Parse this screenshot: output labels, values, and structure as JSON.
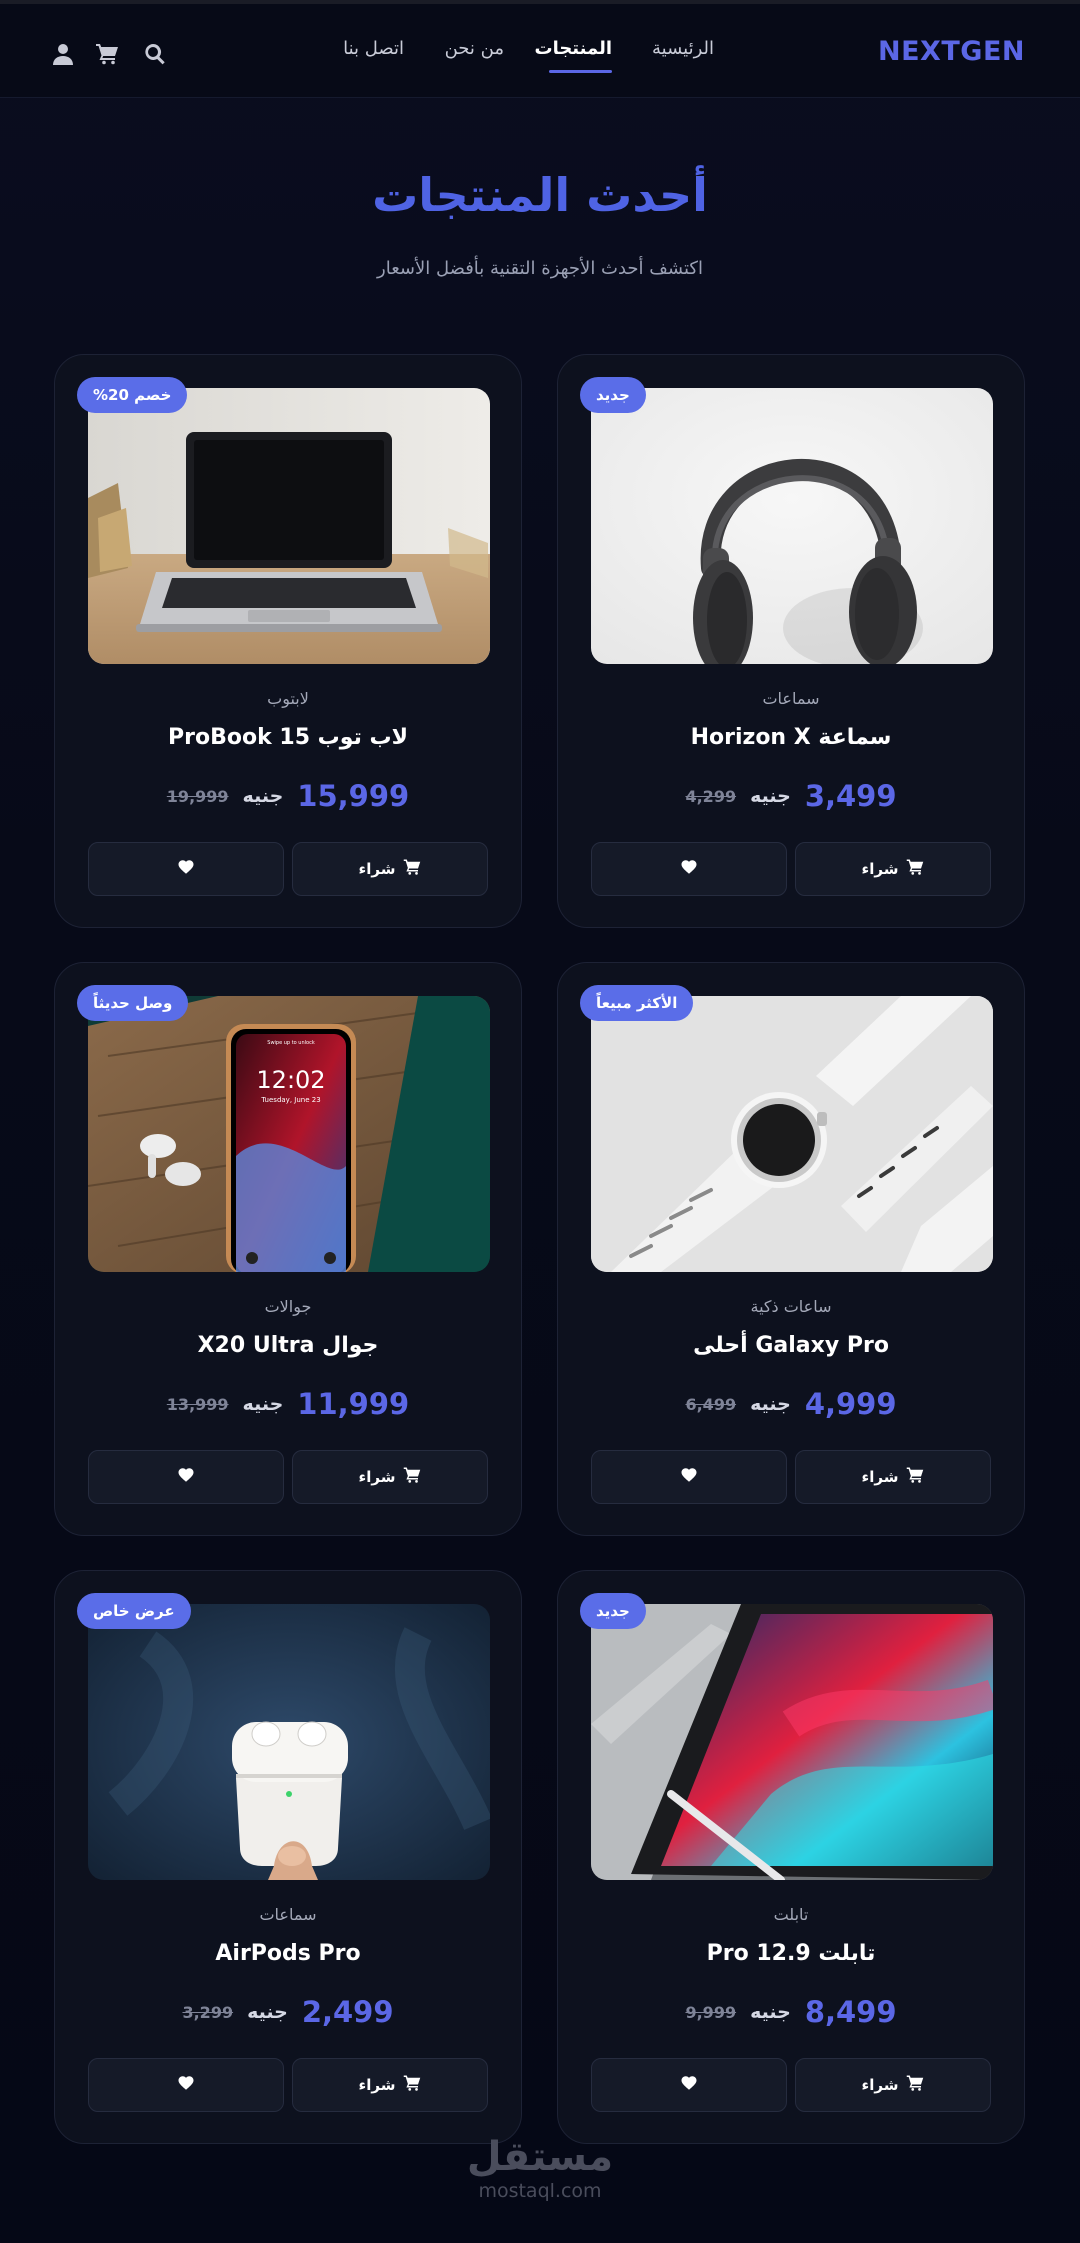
{
  "header": {
    "logo": "NEXTGEN",
    "nav": [
      "الرئيسية",
      "المنتجات",
      "من نحن",
      "اتصل بنا"
    ],
    "active_nav": "المنتجات",
    "icons": [
      "search-icon",
      "cart-icon",
      "user-icon"
    ]
  },
  "hero": {
    "title": "أحدث المنتجات",
    "subtitle": "اكتشف أحدث الأجهزة التقنية بأفضل الأسعار"
  },
  "products": [
    {
      "badge": "جديد",
      "category": "سماعات",
      "name": "سماعة Horizon X",
      "price": "3,499",
      "currency": "جنيه",
      "old_price": "4,299",
      "image": "headphones"
    },
    {
      "badge": "خصم 20%",
      "category": "لابتوب",
      "name": "لاب توب ProBook 15",
      "price": "15,999",
      "currency": "جنيه",
      "old_price": "19,999",
      "image": "laptop"
    },
    {
      "badge": "الأكثر مبيعاً",
      "category": "ساعات ذكية",
      "name": "Galaxy Pro أحلى",
      "price": "4,999",
      "currency": "جنيه",
      "old_price": "6,499",
      "image": "smartwatch"
    },
    {
      "badge": "وصل حديثاً",
      "category": "جوالات",
      "name": "جوال X20 Ultra",
      "price": "11,999",
      "currency": "جنيه",
      "old_price": "13,999",
      "image": "phone"
    },
    {
      "badge": "جديد",
      "category": "تابلت",
      "name": "تابلت Pro 12.9",
      "price": "8,499",
      "currency": "جنيه",
      "old_price": "9,999",
      "image": "tablet"
    },
    {
      "badge": "عرض خاص",
      "category": "سماعات",
      "name": "AirPods Pro",
      "price": "2,499",
      "currency": "جنيه",
      "old_price": "3,299",
      "image": "earbuds"
    }
  ],
  "buttons": {
    "buy": "شراء",
    "buy_icon": "cart-icon",
    "fav_icon": "heart-icon"
  },
  "phone_screen": {
    "time": "12:02",
    "date": "Tuesday, June 23",
    "swipe": "Swipe up to unlock"
  },
  "watermark": {
    "ar": "مستقل",
    "en": "mostaql.com"
  },
  "colors": {
    "accent": "#5b67e6",
    "badge": "#5a6de8",
    "background": "#070a18",
    "card": "#0d111e"
  }
}
